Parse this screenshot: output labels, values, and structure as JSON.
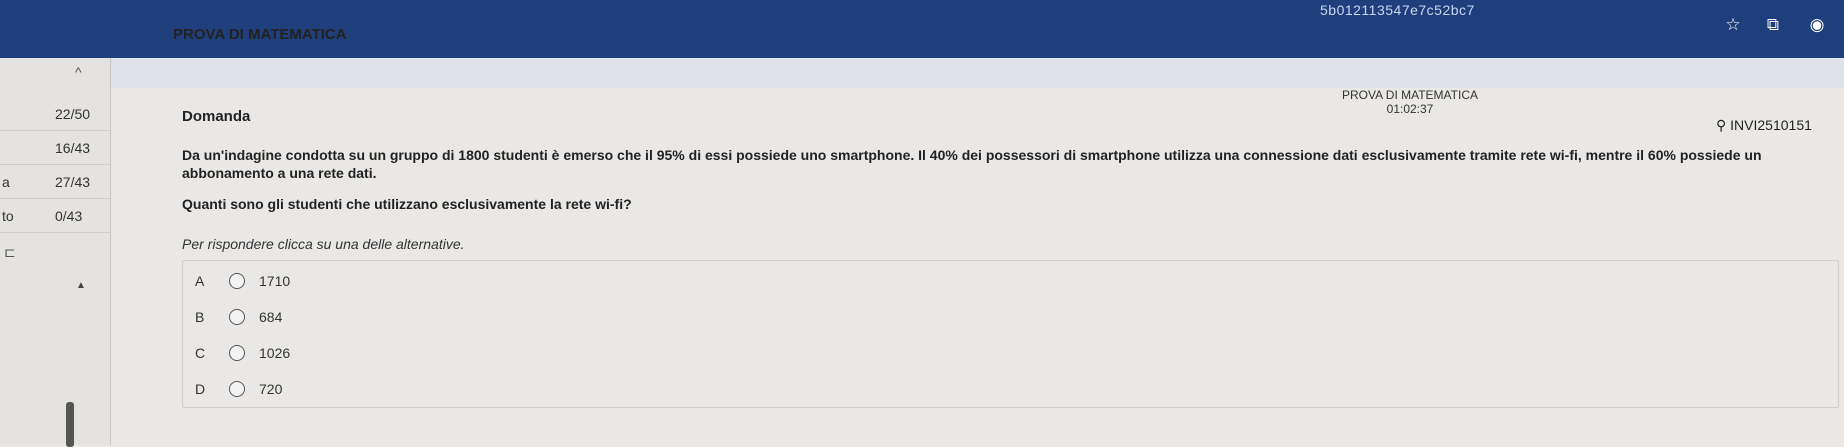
{
  "browser": {
    "url_fragment": "5b012113547e7c52bc7",
    "icons": [
      "star-icon",
      "extension-icon",
      "profile-icon"
    ]
  },
  "app": {
    "title": "PROVA DI MATEMATICA"
  },
  "sidebar": {
    "items": [
      {
        "prefix": "",
        "count": "22/50"
      },
      {
        "prefix": "",
        "count": "16/43"
      },
      {
        "prefix": "a",
        "count": "27/43"
      },
      {
        "prefix": "to",
        "count": "0/43"
      }
    ]
  },
  "exam": {
    "name": "PROVA DI MATEMATICA",
    "timer": "01:02:37",
    "user_id": "INVI2510151"
  },
  "question": {
    "heading": "Domanda",
    "text": "Da un'indagine condotta su un gruppo di 1800 studenti è emerso che il 95% di essi possiede uno smartphone. Il 40% dei possessori di smartphone utilizza una connessione dati esclusivamente tramite rete wi-fi, mentre il 60% possiede un abbonamento a una rete dati.",
    "prompt": "Quanti sono gli studenti che utilizzano esclusivamente la rete wi-fi?",
    "instruction": "Per rispondere clicca su una delle alternative."
  },
  "answers": [
    {
      "letter": "A",
      "value": "1710"
    },
    {
      "letter": "B",
      "value": "684"
    },
    {
      "letter": "C",
      "value": "1026"
    },
    {
      "letter": "D",
      "value": "720"
    }
  ]
}
